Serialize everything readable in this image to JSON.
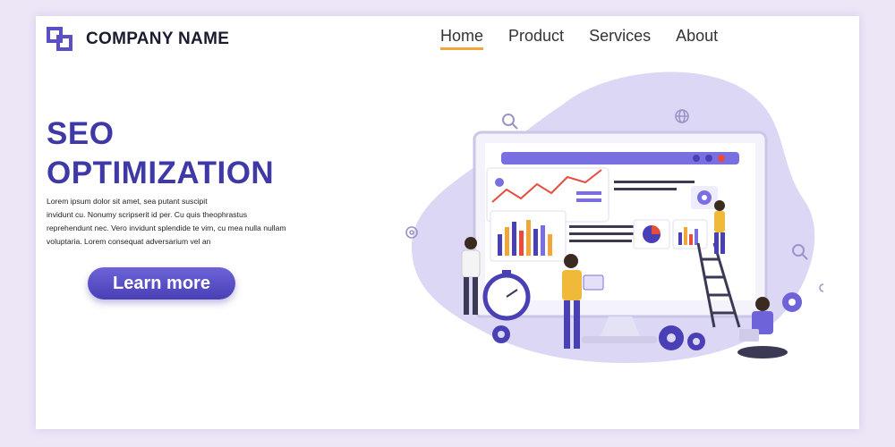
{
  "brand": {
    "name": "COMPANY NAME"
  },
  "nav": {
    "items": [
      {
        "label": "Home",
        "active": true
      },
      {
        "label": "Product",
        "active": false
      },
      {
        "label": "Services",
        "active": false
      },
      {
        "label": "About",
        "active": false
      }
    ]
  },
  "hero": {
    "title_line1": "SEO",
    "title_line2": "OPTIMIZATION",
    "description_lines": [
      "Lorem ipsum dolor sit amet, sea putant suscipit",
      "invidunt cu. Nonumy scripserit id per. Cu quis theophrastus",
      "reprehendunt nec. Vero invidunt splendide te vim, cu mea nulla nullam",
      "voluptaria. Lorem consequat adversarium vel an"
    ],
    "cta_label": "Learn more"
  },
  "colors": {
    "accent": "#5b4fc4",
    "title": "#3f39a8",
    "nav_underline": "#f0a63a",
    "blob": "#dcd7f5",
    "background": "#ece6f7"
  },
  "icons": [
    "logo-squares-icon",
    "search-icon",
    "globe-icon",
    "gear-icon",
    "location-pin-icon",
    "stopwatch-icon",
    "ladder-icon",
    "laptop-icon"
  ]
}
